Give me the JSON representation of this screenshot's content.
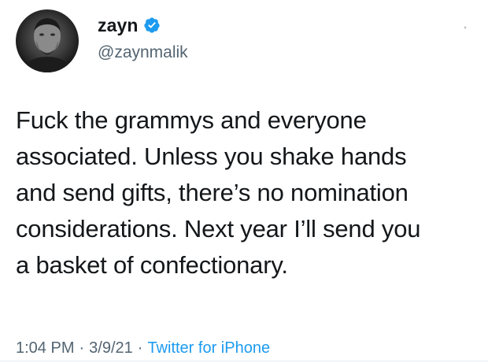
{
  "tweet": {
    "display_name": "zayn",
    "handle": "@zaynmalik",
    "verified_icon": "verified-badge-icon",
    "more_icon": "more-options-icon",
    "text": "Fuck the grammys and everyone\nassociated. Unless you shake hands\nand send gifts, there’s no nomination\nconsiderations. Next year I’ll send you\na basket of confectionary.",
    "time": "1:04 PM",
    "separator": "·",
    "date": "3/9/21",
    "source": "Twitter for iPhone"
  },
  "colors": {
    "text": "#14171a",
    "secondary": "#536471",
    "accent": "#1d9bf0"
  }
}
